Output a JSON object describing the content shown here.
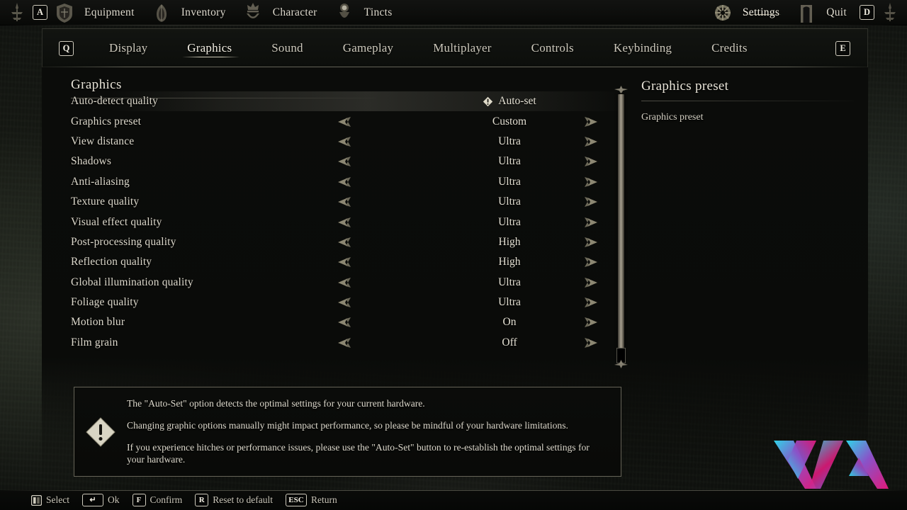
{
  "topbar": {
    "left_key": "A",
    "right_key": "D",
    "items": [
      {
        "label": "Equipment",
        "icon": "shield-emblem-icon",
        "active": false
      },
      {
        "label": "Inventory",
        "icon": "satchel-emblem-icon",
        "active": false
      },
      {
        "label": "Character",
        "icon": "crown-emblem-icon",
        "active": false
      },
      {
        "label": "Tincts",
        "icon": "flask-emblem-icon",
        "active": false
      }
    ],
    "right_items": [
      {
        "label": "Settings",
        "icon": "gear-emblem-icon",
        "active": true
      },
      {
        "label": "Quit",
        "icon": "door-emblem-icon",
        "active": false
      }
    ]
  },
  "tabbar": {
    "left_key": "Q",
    "right_key": "E",
    "tabs": [
      {
        "label": "Display",
        "active": false
      },
      {
        "label": "Graphics",
        "active": true
      },
      {
        "label": "Sound",
        "active": false
      },
      {
        "label": "Gameplay",
        "active": false
      },
      {
        "label": "Multiplayer",
        "active": false
      },
      {
        "label": "Controls",
        "active": false
      },
      {
        "label": "Keybinding",
        "active": false
      },
      {
        "label": "Credits",
        "active": false
      }
    ]
  },
  "section": {
    "title": "Graphics",
    "rows": [
      {
        "label": "Auto-detect quality",
        "value": "Auto-set",
        "selected": true,
        "arrows": false,
        "warn": true
      },
      {
        "label": "Graphics preset",
        "value": "Custom",
        "selected": false,
        "arrows": true,
        "warn": false
      },
      {
        "label": "View distance",
        "value": "Ultra",
        "selected": false,
        "arrows": true,
        "warn": false
      },
      {
        "label": "Shadows",
        "value": "Ultra",
        "selected": false,
        "arrows": true,
        "warn": false
      },
      {
        "label": "Anti-aliasing",
        "value": "Ultra",
        "selected": false,
        "arrows": true,
        "warn": false
      },
      {
        "label": "Texture quality",
        "value": "Ultra",
        "selected": false,
        "arrows": true,
        "warn": false
      },
      {
        "label": "Visual effect quality",
        "value": "Ultra",
        "selected": false,
        "arrows": true,
        "warn": false
      },
      {
        "label": "Post-processing quality",
        "value": "High",
        "selected": false,
        "arrows": true,
        "warn": false
      },
      {
        "label": "Reflection quality",
        "value": "High",
        "selected": false,
        "arrows": true,
        "warn": false
      },
      {
        "label": "Global illumination quality",
        "value": "Ultra",
        "selected": false,
        "arrows": true,
        "warn": false
      },
      {
        "label": "Foliage quality",
        "value": "Ultra",
        "selected": false,
        "arrows": true,
        "warn": false
      },
      {
        "label": "Motion blur",
        "value": "On",
        "selected": false,
        "arrows": true,
        "warn": false
      },
      {
        "label": "Film grain",
        "value": "Off",
        "selected": false,
        "arrows": true,
        "warn": false
      }
    ]
  },
  "right_panel": {
    "title": "Graphics preset",
    "description": "Graphics preset"
  },
  "info_box": {
    "icon": "warning-diamond-icon",
    "lines": [
      "The \"Auto-Set\" option detects the optimal settings for your current hardware.",
      "Changing graphic options manually might impact performance, so please be mindful of your hardware limitations.",
      "If you experience hitches or performance issues, please use the \"Auto-Set\" button to re-establish the optimal settings for your hardware."
    ]
  },
  "bottom_hints": [
    {
      "key": "",
      "icon": "dpad-icon",
      "label": "Select"
    },
    {
      "key": "↵",
      "icon": "",
      "label": "Ok"
    },
    {
      "key": "F",
      "icon": "",
      "label": "Confirm"
    },
    {
      "key": "R",
      "icon": "",
      "label": "Reset to default"
    },
    {
      "key": "ESC",
      "icon": "",
      "label": "Return"
    }
  ],
  "colors": {
    "accent_cyan": "#2fd4e8",
    "accent_magenta": "#e0197a",
    "accent_purple": "#8a52c8",
    "text": "#ddd9cc",
    "panel_bg": "#0b0c0a"
  }
}
